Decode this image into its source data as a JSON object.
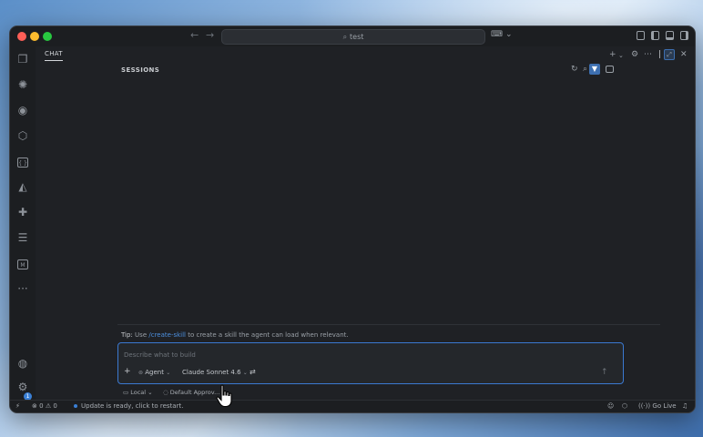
{
  "window": {
    "search_text": "test",
    "colors": {
      "accent": "#3b79d1",
      "link": "#4d90e0",
      "background": "#1f2125"
    }
  },
  "activity_bar": {
    "icons": [
      "files-icon",
      "openai-icon",
      "github-icon",
      "package-icon",
      "json-icon",
      "triangle-icon",
      "python-icon",
      "outline-icon",
      "markdown-icon"
    ],
    "more_label": "···",
    "badge_count": "1"
  },
  "panel": {
    "tab_label": "CHAT",
    "sessions_label": "SESSIONS"
  },
  "tip": {
    "label": "Tip:",
    "prefix": "Use",
    "command": "/create-skill",
    "suffix": "to create a skill the agent can load when relevant."
  },
  "chat_input": {
    "placeholder": "Describe what to build",
    "add_label": "+",
    "mode_label": "Agent",
    "model_label": "Claude Sonnet 4.6"
  },
  "below_input": {
    "location_label": "Local",
    "approvals_label": "Default Approv..."
  },
  "status_bar": {
    "errors": "0",
    "warnings": "0",
    "update_message": "Update is ready, click to restart.",
    "go_live_label": "Go Live"
  }
}
